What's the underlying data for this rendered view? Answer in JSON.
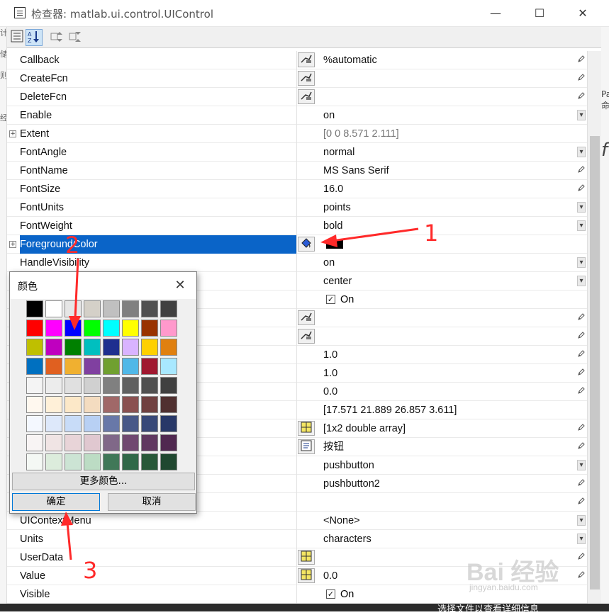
{
  "window": {
    "title": "检查器:  matlab.ui.control.UIControl",
    "minimize": "—",
    "maximize": "☐",
    "close": "✕"
  },
  "toolbar": {
    "categorized_icon": "categorized-icon",
    "sort_icon": "sort-az-icon",
    "expand_icon": "expand-all-icon",
    "collapse_icon": "collapse-all-icon"
  },
  "left_strip_chars": [
    "计",
    "储",
    "则",
    "",
    "",
    "",
    "经"
  ],
  "right_strip_chars": [
    "Pa",
    "命",
    "",
    "f"
  ],
  "properties": [
    {
      "name": "Callback",
      "editor": "callback",
      "value": "%automatic",
      "control": "pencil"
    },
    {
      "name": "CreateFcn",
      "editor": "callback",
      "value": "",
      "control": "pencil"
    },
    {
      "name": "DeleteFcn",
      "editor": "callback",
      "value": "",
      "control": "pencil"
    },
    {
      "name": "Enable",
      "editor": "",
      "value": "on",
      "control": "dropdown"
    },
    {
      "name": "Extent",
      "expander": true,
      "editor": "",
      "value": "[0 0 8.571 2.111]",
      "gray": true,
      "control": ""
    },
    {
      "name": "FontAngle",
      "editor": "",
      "value": "normal",
      "control": "dropdown"
    },
    {
      "name": "FontName",
      "editor": "",
      "value": "MS Sans Serif",
      "control": "pencil"
    },
    {
      "name": "FontSize",
      "editor": "",
      "value": "16.0",
      "control": "pencil"
    },
    {
      "name": "FontUnits",
      "editor": "",
      "value": "points",
      "control": "dropdown"
    },
    {
      "name": "FontWeight",
      "editor": "",
      "value": "bold",
      "control": "dropdown"
    },
    {
      "name": "ForegroundColor",
      "expander": true,
      "selected": true,
      "editor": "paint",
      "value": "",
      "swatch": "#000000",
      "control": ""
    },
    {
      "name": "HandleVisibility",
      "editor": "",
      "value": "on",
      "control": "dropdown"
    },
    {
      "name": "",
      "editor": "",
      "value": "center",
      "control": "dropdown"
    },
    {
      "name": "",
      "editor": "",
      "value": "",
      "check": "On",
      "control": ""
    },
    {
      "name": "",
      "editor": "callback",
      "value": "",
      "control": "pencil"
    },
    {
      "name": "",
      "editor": "callback",
      "value": "",
      "control": "pencil"
    },
    {
      "name": "",
      "editor": "",
      "value": "1.0",
      "control": "pencil"
    },
    {
      "name": "",
      "editor": "",
      "value": "1.0",
      "control": "pencil"
    },
    {
      "name": "",
      "editor": "",
      "value": "0.0",
      "control": "pencil"
    },
    {
      "name": "",
      "editor": "",
      "value": "[17.571 21.889 26.857 3.611]",
      "control": ""
    },
    {
      "name": "",
      "editor": "grid",
      "value": "[1x2  double array]",
      "control": "pencil"
    },
    {
      "name": "",
      "editor": "text",
      "value": "按钮",
      "control": "pencil"
    },
    {
      "name": "",
      "editor": "",
      "value": "pushbutton",
      "control": "dropdown"
    },
    {
      "name": "",
      "editor": "",
      "value": "pushbutton2",
      "control": "pencil"
    },
    {
      "name": "",
      "editor": "",
      "value": "",
      "control": "pencil"
    },
    {
      "name": "UIContextMenu",
      "editor": "",
      "value": "<None>",
      "control": "dropdown"
    },
    {
      "name": "Units",
      "editor": "",
      "value": "characters",
      "control": "dropdown"
    },
    {
      "name": "UserData",
      "editor": "grid",
      "value": "",
      "control": "pencil"
    },
    {
      "name": "Value",
      "editor": "grid",
      "value": "0.0",
      "control": "pencil"
    },
    {
      "name": "Visible",
      "editor": "",
      "value": "",
      "check": "On",
      "control": ""
    }
  ],
  "color_dialog": {
    "title": "颜色",
    "more_colors": "更多颜色...",
    "ok": "确定",
    "cancel": "取消",
    "palette": [
      [
        "#000000",
        "#ffffff",
        "#e6e6e6",
        "#d4d0c8",
        "#c0c0c0",
        "#808080",
        "#505050",
        "#404040"
      ],
      [
        "#ff0000",
        "#ff00ff",
        "#0000ff",
        "#00ff00",
        "#00ffff",
        "#ffff00",
        "#993300",
        "#ff99cc"
      ],
      [
        "#bfbf00",
        "#bf00bf",
        "#008000",
        "#00bfbf",
        "#1f2f8f",
        "#d9b3ff",
        "#ffd000",
        "#e08010"
      ],
      [
        "#0070c0",
        "#e06020",
        "#f0b030",
        "#8040a0",
        "#70a030",
        "#50b8e8",
        "#a01830",
        "#a8e8ff"
      ],
      [
        "#f4f4f4",
        "#ececec",
        "#e0e0e0",
        "#d0d0d0",
        "#808080",
        "#606060",
        "#505050",
        "#404040"
      ],
      [
        "#fff8ef",
        "#fff0d8",
        "#fce8c8",
        "#f4dcc0",
        "#a06868",
        "#8a5050",
        "#704040",
        "#503030"
      ],
      [
        "#f4f8ff",
        "#dde8fa",
        "#c8dcf8",
        "#b8d0f4",
        "#6878a8",
        "#485888",
        "#384878",
        "#283868"
      ],
      [
        "#f8f4f4",
        "#f0e4e4",
        "#e8d4d8",
        "#e0c8d0",
        "#806888",
        "#704870",
        "#603860",
        "#502850"
      ],
      [
        "#f4f8f4",
        "#dcecdc",
        "#cce4d4",
        "#bcdcc4",
        "#407858",
        "#306848",
        "#285838",
        "#204830"
      ]
    ]
  },
  "annotations": [
    "1",
    "2",
    "3"
  ],
  "watermark": {
    "brand": "Bai 经验",
    "url": "jingyan.baidu.com"
  },
  "footer_text": "选择文件以查看详细信息"
}
